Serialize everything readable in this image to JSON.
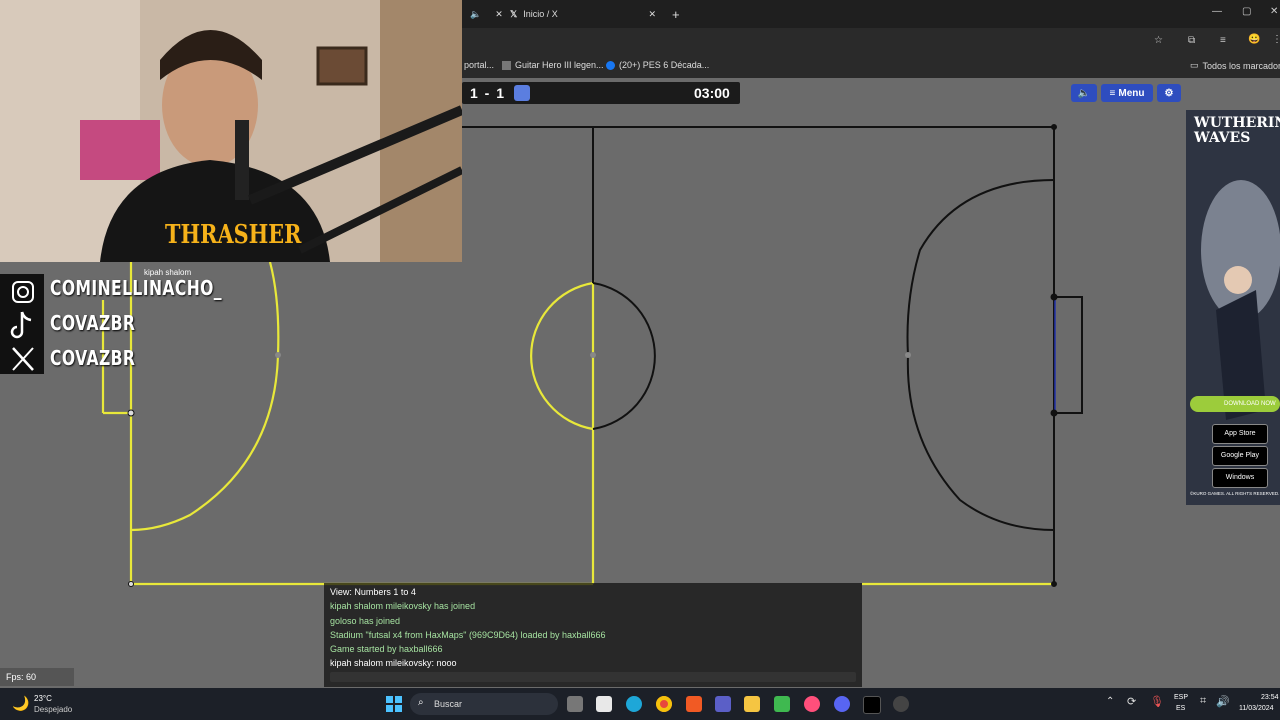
{
  "browser": {
    "tabs": [
      {
        "label": "",
        "active": false
      },
      {
        "label": "Inicio / X",
        "active": true
      }
    ],
    "new_tab": "+",
    "bookmarks": [
      "portal...",
      "Guitar Hero III legen...",
      "(20+) PES 6 Década..."
    ],
    "all_bookmarks": "Todos los marcadores"
  },
  "game": {
    "score": "1 - 1",
    "timer": "03:00",
    "menu_label": "Menu",
    "player_name": "kipah shalom",
    "fps": "Fps: 60",
    "chat": [
      {
        "text": "View: Numbers 1 to 4",
        "color": "#ffffff"
      },
      {
        "text": "kipah shalom mileikovsky has joined",
        "color": "#a6e3a1"
      },
      {
        "text": "goloso has joined",
        "color": "#a6e3a1"
      },
      {
        "text": "Stadium \"futsal x4 from HaxMaps\" (969C9D64) loaded by haxball666",
        "color": "#a6e3a1"
      },
      {
        "text": "Game started by haxball666",
        "color": "#a6e3a1"
      },
      {
        "text": "kipah shalom mileikovsky: nooo",
        "color": "#ffffff"
      }
    ],
    "colors": {
      "field": "#6b6b6b",
      "red_line": "#e8e83a",
      "blue_line": "#111111",
      "accent": "#2e4dbf"
    }
  },
  "stream": {
    "socials": [
      {
        "icon": "instagram-icon",
        "handle": "COMINELLINACHO_"
      },
      {
        "icon": "tiktok-icon",
        "handle": "COVAZBR"
      },
      {
        "icon": "x-icon",
        "handle": "COVAZBR"
      }
    ],
    "shirt_text": "THRASHER"
  },
  "ad": {
    "title": "WUTHERING WAVES",
    "download": "DOWNLOAD NOW",
    "stores": [
      "App Store",
      "Google Play",
      "Windows"
    ],
    "footer": "©KURO GAMES. ALL RIGHTS RESERVED."
  },
  "taskbar": {
    "weather_temp": "23°C",
    "weather_desc": "Despejado",
    "search": "Buscar",
    "lang": "ESP",
    "lang2": "ES",
    "time": "23:54",
    "date": "11/03/2024"
  }
}
